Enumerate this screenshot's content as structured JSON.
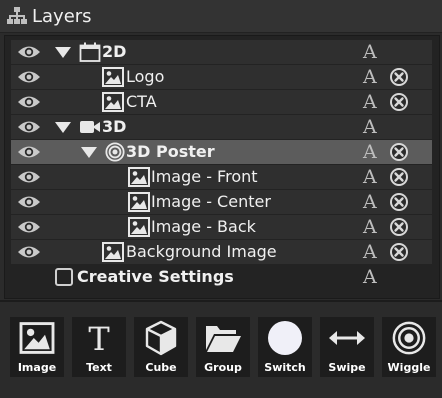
{
  "panel": {
    "title": "Layers",
    "icon": "layers-hierarchy-icon"
  },
  "layers": [
    {
      "id": "2d",
      "label": "2D",
      "type": "folder",
      "icon": "calendar-folder-icon",
      "expanded": true,
      "visible": true,
      "lock_label": "A",
      "deletable": false,
      "bold": true
    },
    {
      "id": "logo",
      "label": "Logo",
      "type": "image",
      "icon": "image-icon",
      "visible": true,
      "lock_label": "A",
      "deletable": true
    },
    {
      "id": "cta",
      "label": "CTA",
      "type": "image",
      "icon": "image-icon",
      "visible": true,
      "lock_label": "A",
      "deletable": true
    },
    {
      "id": "3d",
      "label": "3D",
      "type": "folder",
      "icon": "video-camera-icon",
      "expanded": true,
      "visible": true,
      "lock_label": "A",
      "deletable": false,
      "bold": true
    },
    {
      "id": "poster",
      "label": "3D Poster",
      "type": "poster",
      "icon": "wiggle-target-icon",
      "expanded": true,
      "visible": true,
      "lock_label": "A",
      "deletable": true,
      "selected": true,
      "bold": true
    },
    {
      "id": "front",
      "label": "Image - Front",
      "type": "image",
      "icon": "image-icon",
      "visible": true,
      "lock_label": "A",
      "deletable": true
    },
    {
      "id": "center",
      "label": "Image - Center",
      "type": "image",
      "icon": "image-icon",
      "visible": true,
      "lock_label": "A",
      "deletable": true
    },
    {
      "id": "back",
      "label": "Image - Back",
      "type": "image",
      "icon": "image-icon",
      "visible": true,
      "lock_label": "A",
      "deletable": true
    },
    {
      "id": "bg",
      "label": "Background Image",
      "type": "image",
      "icon": "image-icon",
      "visible": true,
      "lock_label": "A",
      "deletable": true
    },
    {
      "id": "settings",
      "label": "Creative Settings",
      "type": "settings",
      "checked": false,
      "lock_label": "A",
      "deletable": false,
      "bold": true
    }
  ],
  "toolbar": {
    "tools": [
      {
        "label": "Image",
        "icon": "image-icon"
      },
      {
        "label": "Text",
        "icon": "text-t-icon"
      },
      {
        "label": "Cube",
        "icon": "cube-icon"
      },
      {
        "label": "Group",
        "icon": "folder-open-icon"
      },
      {
        "label": "Switch",
        "icon": "circle-icon"
      },
      {
        "label": "Swipe",
        "icon": "double-arrow-icon"
      },
      {
        "label": "Wiggle",
        "icon": "target-icon"
      }
    ]
  },
  "colors": {
    "background": "#2b2b2b",
    "tree_background": "#232323",
    "row_shade": "#2f2f2f",
    "selected_row": "#5c5c5c",
    "icon_fill": "#e8e8e8"
  }
}
